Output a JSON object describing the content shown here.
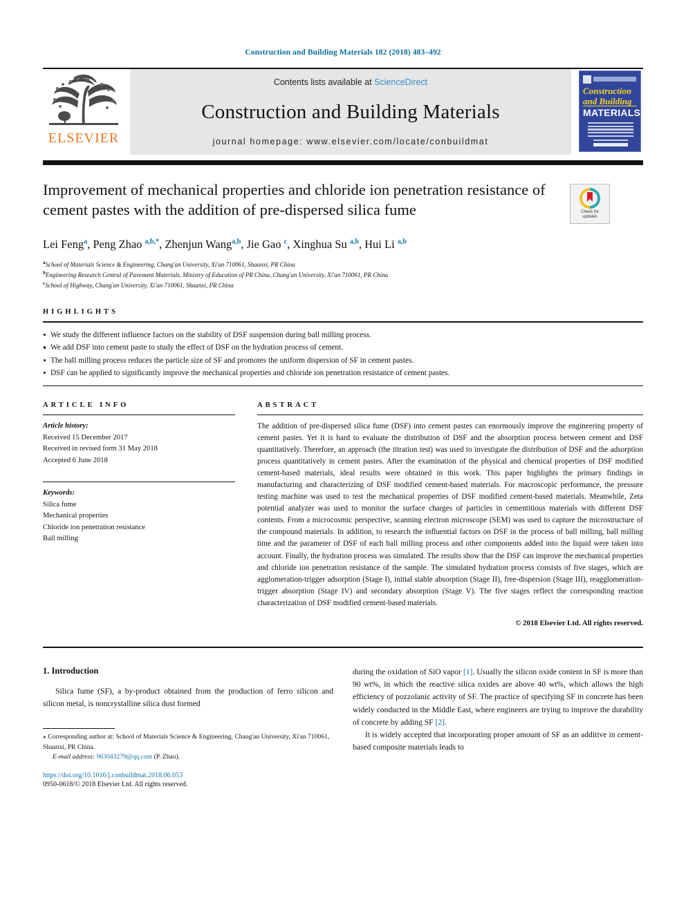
{
  "running_head": "Construction and Building Materials 182 (2018) 483–492",
  "masthead": {
    "contents_prefix": "Contents lists available at ",
    "sciencedirect": "ScienceDirect",
    "journal_title": "Construction and Building Materials",
    "homepage": "journal homepage: www.elsevier.com/locate/conbuildmat",
    "publisher": "ELSEVIER",
    "cover": {
      "line1": "Construction",
      "line2": "and Building",
      "line3": "MATERIALS"
    },
    "colors": {
      "running_head": "#0b6e9b",
      "sciencedirect_link": "#3a8cc8",
      "elsevier_orange": "#E87722",
      "cover_blue": "#31469b",
      "cover_yellow": "#f5d22a"
    }
  },
  "article": {
    "title": "Improvement of mechanical properties and chloride ion penetration resistance of cement pastes with the addition of pre-dispersed silica fume",
    "crossmark": {
      "line1": "Check for",
      "line2": "updates"
    },
    "authors": [
      {
        "name": "Lei Feng",
        "sup": "a"
      },
      {
        "name": "Peng Zhao",
        "sup": "a,b,*"
      },
      {
        "name": "Zhenjun Wang",
        "sup": "a,b"
      },
      {
        "name": "Jie Gao",
        "sup": "c"
      },
      {
        "name": "Xinghua Su",
        "sup": "a,b"
      },
      {
        "name": "Hui Li",
        "sup": "a,b"
      }
    ],
    "affiliations": [
      {
        "marker": "a",
        "text": "School of Materials Science & Engineering, Chang'an University, Xi'an 710061, Shaanxi, PR China"
      },
      {
        "marker": "b",
        "text": "Engineering Research Central of Pavement Materials, Ministry of Education of PR China, Chang'an University, Xi'an 710061, PR China"
      },
      {
        "marker": "c",
        "text": "School of Highway, Chang'an University, Xi'an 710061, Shaanxi, PR China"
      }
    ]
  },
  "highlights": {
    "heading": "HIGHLIGHTS",
    "items": [
      "We study the different influence factors on the stability of DSF suspension during ball milling process.",
      "We add DSF into cement paste to study the effect of DSF on the hydration process of cement.",
      "The ball milling process reduces the particle size of SF and promotes the uniform dispersion of SF in cement pastes.",
      "DSF can be applied to significantly improve the mechanical properties and chloride ion penetration resistance of cement pastes."
    ]
  },
  "article_info": {
    "heading": "ARTICLE INFO",
    "history_label": "Article history:",
    "history": [
      "Received 15 December 2017",
      "Received in revised form 31 May 2018",
      "Accepted 6 June 2018"
    ],
    "keywords_label": "Keywords:",
    "keywords": [
      "Silica fume",
      "Mechanical properties",
      "Chloride ion penetration resistance",
      "Ball milling"
    ]
  },
  "abstract": {
    "heading": "ABSTRACT",
    "text": "The addition of pre-dispersed silica fume (DSF) into cement pastes can enormously improve the engineering property of cement pastes. Yet it is hard to evaluate the distribution of DSF and the absorption process between cement and DSF quantitatively. Therefore, an approach (the titration test) was used to investigate the distribution of DSF and the adsorption process quantitatively in cement pastes. After the examination of the physical and chemical properties of DSF modified cement-based materials, ideal results were obtained in this work. This paper highlights the primary findings in manufacturing and characterizing of DSF modified cement-based materials. For macroscopic performance, the pressure testing machine was used to test the mechanical properties of DSF modified cement-based materials. Meanwhile, Zeta potential analyzer was used to monitor the surface charges of particles in cementitious materials with different DSF contents. From a microcosmic perspective, scanning electron microscope (SEM) was used to capture the microstructure of the compound materials. In addition, to research the influential factors on DSF in the process of ball milling, ball milling time and the parameter of DSF of each ball milling process and other components added into the liquid were taken into account. Finally, the hydration process was simulated. The results show that the DSF can improve the mechanical properties and chloride ion penetration resistance of the sample. The simulated hydration process consists of five stages, which are agglomeration-trigger adsorption (Stage I), initial stable absorption (Stage II), free-dispersion (Stage III), reagglomeration-trigger absorption (Stage IV) and secondary absorption (Stage V). The five stages reflect the corresponding reaction characterization of DSF modified cement-based materials.",
    "copyright": "© 2018 Elsevier Ltd. All rights reserved."
  },
  "introduction": {
    "heading": "1. Introduction",
    "left_paragraph": "Silica fume (SF), a by-product obtained from the production of ferro silicon and silicon metal, is noncrystalline silica dust formed",
    "right_paragraph_1_a": "during the oxidation of SiO vapor ",
    "right_ref_1": "[1]",
    "right_paragraph_1_b": ". Usually the silicon oxide content in SF is more than 90 wt%, in which the reactive silica oxides are above 40 wt%, which allows the high efficiency of pozzolanic activity of SF. The practice of specifying SF in concrete has been widely conducted in the Middle East, where engineers are trying to improve the durability of concrete by adding SF ",
    "right_ref_2": "[2]",
    "right_paragraph_1_c": ".",
    "right_paragraph_2": "It is widely accepted that incorporating proper amount of SF as an additive in cement-based composite materials leads to"
  },
  "footnote": {
    "corresponding": "⁎ Corresponding author at: School of Materials Science & Engineering, Chang'an University, Xi'an 710061, Shaanxi, PR China.",
    "email_label": "E-mail address:",
    "email": "963043279@qq.com",
    "email_suffix": " (P. Zhao).",
    "doi": "https://doi.org/10.1016/j.conbuildmat.2018.06.053",
    "issn": "0950-0618/© 2018 Elsevier Ltd. All rights reserved."
  }
}
